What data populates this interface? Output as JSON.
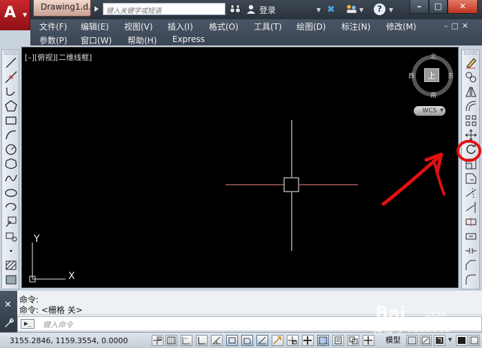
{
  "window": {
    "app_logo": "A",
    "document_tab": "Drawing1.d...",
    "search_placeholder": "键入关键字或短语",
    "login_label": "登录",
    "help_label": "?",
    "minimize": "–",
    "maximize": "□",
    "close": "✕"
  },
  "menu": {
    "row1": [
      "文件(F)",
      "编辑(E)",
      "视图(V)",
      "插入(I)",
      "格式(O)",
      "工具(T)",
      "绘图(D)",
      "标注(N)",
      "修改(M)"
    ],
    "row2": [
      "参数(P)",
      "窗口(W)",
      "帮助(H)",
      "Express"
    ],
    "mdi_buttons": "–□✕"
  },
  "viewport": {
    "label": "[–][俯视][二维线框]",
    "viewcube": {
      "north": "北",
      "south": "南",
      "west": "西",
      "east": "东",
      "top_face": "上"
    },
    "wcs_label": "WCS",
    "ucs_x": "X",
    "ucs_y": "Y"
  },
  "command": {
    "history": [
      "命令:",
      "命令:  <栅格 关>"
    ],
    "input_placeholder": "键入命令",
    "prompt_icon": "▶_"
  },
  "status": {
    "coords": "3155.2846, 1159.3554, 0.0000",
    "model_label": "模型"
  },
  "watermark": {
    "logo": "Bai",
    "jingyan": "经验",
    "wechat": "微信号 cadbe12"
  },
  "colors": {
    "title_bg": "#2a323c",
    "app_button": "#c9282d",
    "canvas_bg": "#000000",
    "crosshair": "#ffffff",
    "annotation": "#e01010"
  },
  "icons": {
    "left_toolbar": [
      "line-icon",
      "construction-line-icon",
      "polyline-icon",
      "polygon-icon",
      "rectangle-icon",
      "arc-icon",
      "circle-icon",
      "revision-cloud-icon",
      "spline-icon",
      "ellipse-icon",
      "ellipse-arc-icon",
      "insert-block-icon",
      "make-block-icon",
      "point-icon",
      "hatch-icon",
      "gradient-icon"
    ],
    "right_toolbar": [
      "erase-icon",
      "copy-icon",
      "mirror-icon",
      "offset-icon",
      "array-icon",
      "move-icon",
      "rotate-icon",
      "scale-icon",
      "stretch-icon",
      "trim-icon",
      "extend-icon",
      "break-at-point-icon",
      "break-icon",
      "join-icon",
      "chamfer-icon",
      "fillet-icon"
    ]
  }
}
